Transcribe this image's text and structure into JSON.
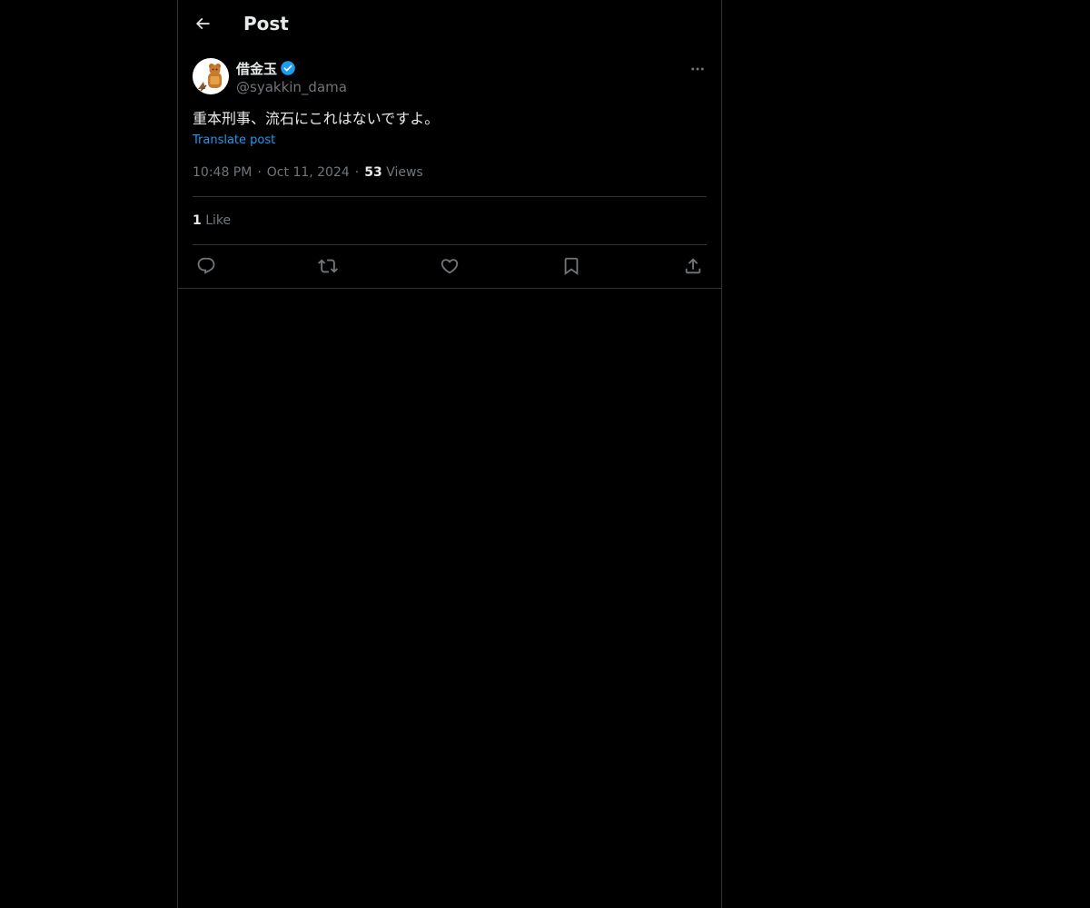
{
  "header": {
    "title": "Post"
  },
  "post": {
    "author": {
      "display_name": "借金玉",
      "handle": "@syakkin_dama",
      "verified": true
    },
    "text": "重本刑事、流石にこれはないですよ。",
    "translate_label": "Translate post",
    "time": "10:48 PM",
    "date": "Oct 11, 2024",
    "views_count": "53",
    "views_label": "Views",
    "likes_count": "1",
    "likes_label": "Like"
  },
  "colors": {
    "background": "#000000",
    "text": "#e7e9ea",
    "muted": "#71767b",
    "accent": "#1d9bf0",
    "border": "#2f3336"
  },
  "icons": {
    "back": "arrow-left-icon",
    "verified": "verified-badge-icon",
    "more": "more-horizontal-icon",
    "reply": "reply-icon",
    "repost": "repost-icon",
    "like": "heart-icon",
    "bookmark": "bookmark-icon",
    "share": "share-icon"
  }
}
